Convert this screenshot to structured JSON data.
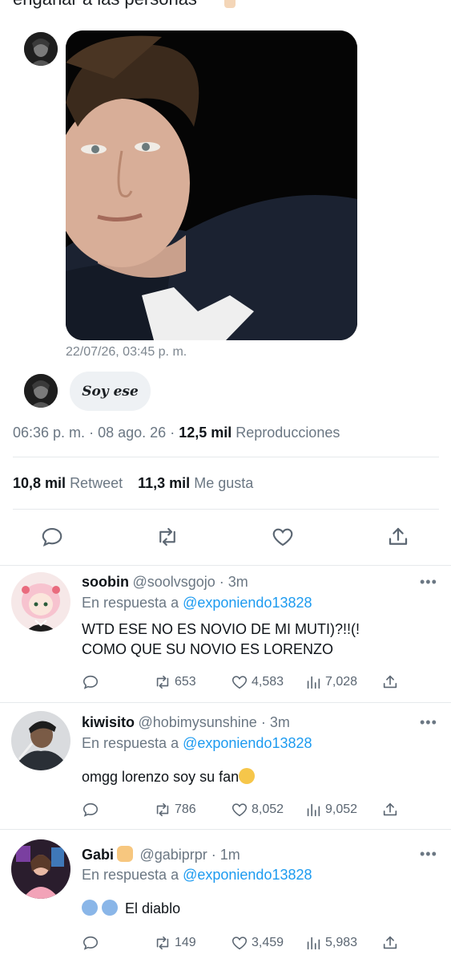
{
  "top_partial_text": "engañar a las personas",
  "dm": {
    "photo_timestamp": "22/07/26, 03:45 p. m.",
    "reply_bubble": "Soy ese"
  },
  "tweet": {
    "time": "06:36 p. m.",
    "sep1": "·",
    "date": "08 ago. 26",
    "sep2": "·",
    "views_count": "12,5 mil",
    "views_label": "Reproducciones",
    "retweets_count": "10,8 mil",
    "retweets_label": "Retweet",
    "likes_count": "11,3 mil",
    "likes_label": "Me gusta"
  },
  "in_reply_prefix": "En respuesta a",
  "replies": [
    {
      "name": "soobin",
      "handle": "@soolvsgojo · 3m",
      "reply_to": "@exponiendo13828",
      "text_line1": "WTD ESE NO ES NOVIO DE MI MUTI)?!!(!",
      "text_line2": "COMO QUE SU NOVIO ES LORENZO",
      "retweets": "653",
      "likes": "4,583",
      "views": "7,028"
    },
    {
      "name": "kiwisito",
      "handle": "@hobimysunshine · 3m",
      "reply_to": "@exponiendo13828",
      "text_line1": "omgg lorenzo soy su fan",
      "retweets": "786",
      "likes": "8,052",
      "views": "9,052"
    },
    {
      "name": "Gabi",
      "handle": "@gabiprpr · 1m",
      "reply_to": "@exponiendo13828",
      "text_line1": "El diablo",
      "retweets": "149",
      "likes": "3,459",
      "views": "5,983"
    }
  ],
  "more_glyph": "•••",
  "icons": {
    "reply": "comment-icon",
    "retweet": "retweet-icon",
    "like": "heart-icon",
    "share": "share-icon",
    "views": "views-icon"
  },
  "colors": {
    "link_blue": "#1d9bf0",
    "grey_text": "#6b7783",
    "bubble_bg": "#eef1f4"
  }
}
